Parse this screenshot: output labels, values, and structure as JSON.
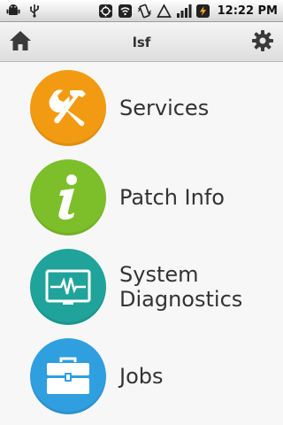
{
  "status_bar": {
    "time": "12:22 PM",
    "icons": [
      "android-icon",
      "usb-icon",
      "gps-icon",
      "wifi-icon",
      "vibrate-icon",
      "alert-triangle-icon",
      "signal-icon",
      "battery-charging-icon"
    ]
  },
  "header": {
    "title": "lsf",
    "home_icon": "home-icon",
    "settings_icon": "gear-icon"
  },
  "menu": {
    "items": [
      {
        "label": "Services",
        "icon": "tools-icon",
        "color": "#f29b12"
      },
      {
        "label": "Patch Info",
        "icon": "info-icon",
        "color": "#7cbf2a"
      },
      {
        "label": "System Diagnostics",
        "icon": "monitor-pulse-icon",
        "color": "#1fa39a"
      },
      {
        "label": "Jobs",
        "icon": "briefcase-icon",
        "color": "#2f9fe0"
      }
    ]
  }
}
